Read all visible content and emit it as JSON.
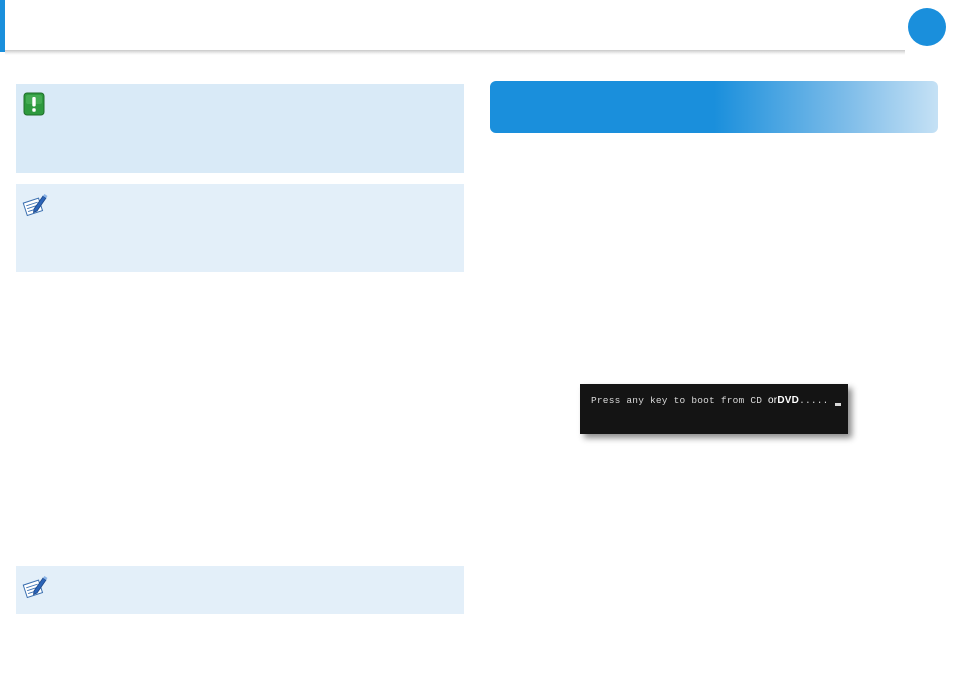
{
  "boot_screen": {
    "text_part1": "Press any key to boot from CD",
    "text_or": "or",
    "text_dvd": "DVD",
    "text_dots": "....."
  },
  "icons": {
    "caution": "exclamation-icon",
    "note": "pen-note-icon"
  },
  "colors": {
    "accent": "#1a8fdc",
    "caution_bg": "#d9eaf7",
    "note_bg": "#e3eff9"
  }
}
